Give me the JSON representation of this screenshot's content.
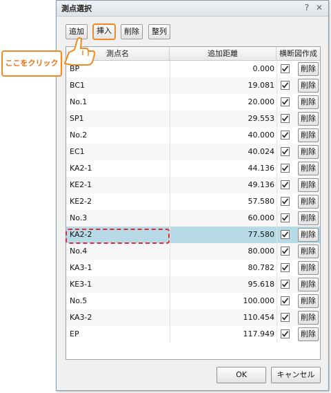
{
  "dialog": {
    "title": "測点選択",
    "help_label": "?",
    "close_label": "✕"
  },
  "toolbar": {
    "add_label": "追加",
    "insert_label": "挿入",
    "delete_label": "削除",
    "sort_label": "整列"
  },
  "table": {
    "headers": [
      "測点名",
      "追加距離",
      "横断図作成"
    ],
    "delete_label": "削除",
    "rows": [
      {
        "name": "BP",
        "distance": "0.000",
        "checked": true
      },
      {
        "name": "BC1",
        "distance": "19.081",
        "checked": true
      },
      {
        "name": "No.1",
        "distance": "20.000",
        "checked": true
      },
      {
        "name": "SP1",
        "distance": "29.553",
        "checked": true
      },
      {
        "name": "No.2",
        "distance": "40.000",
        "checked": true
      },
      {
        "name": "EC1",
        "distance": "40.024",
        "checked": true
      },
      {
        "name": "KA2-1",
        "distance": "44.136",
        "checked": true
      },
      {
        "name": "KE2-1",
        "distance": "49.136",
        "checked": true
      },
      {
        "name": "KE2-2",
        "distance": "57.580",
        "checked": true
      },
      {
        "name": "No.3",
        "distance": "60.000",
        "checked": true
      },
      {
        "name": "KA2-2",
        "distance": "77.580",
        "checked": true
      },
      {
        "name": "No.4",
        "distance": "80.000",
        "checked": true
      },
      {
        "name": "KA3-1",
        "distance": "80.782",
        "checked": true
      },
      {
        "name": "KE3-1",
        "distance": "95.618",
        "checked": true
      },
      {
        "name": "No.5",
        "distance": "100.000",
        "checked": true
      },
      {
        "name": "KA3-2",
        "distance": "110.454",
        "checked": true
      },
      {
        "name": "EP",
        "distance": "117.949",
        "checked": true
      }
    ],
    "selected_row": 10
  },
  "footer": {
    "ok_label": "OK",
    "cancel_label": "キャンセル"
  },
  "annotation": {
    "callout_text": "ここをクリック"
  },
  "colors": {
    "accent_orange": "#f08a1e",
    "callout_text": "#ee6f10",
    "highlight_red": "#e8262e",
    "selected_row": "#b7dbe6"
  }
}
